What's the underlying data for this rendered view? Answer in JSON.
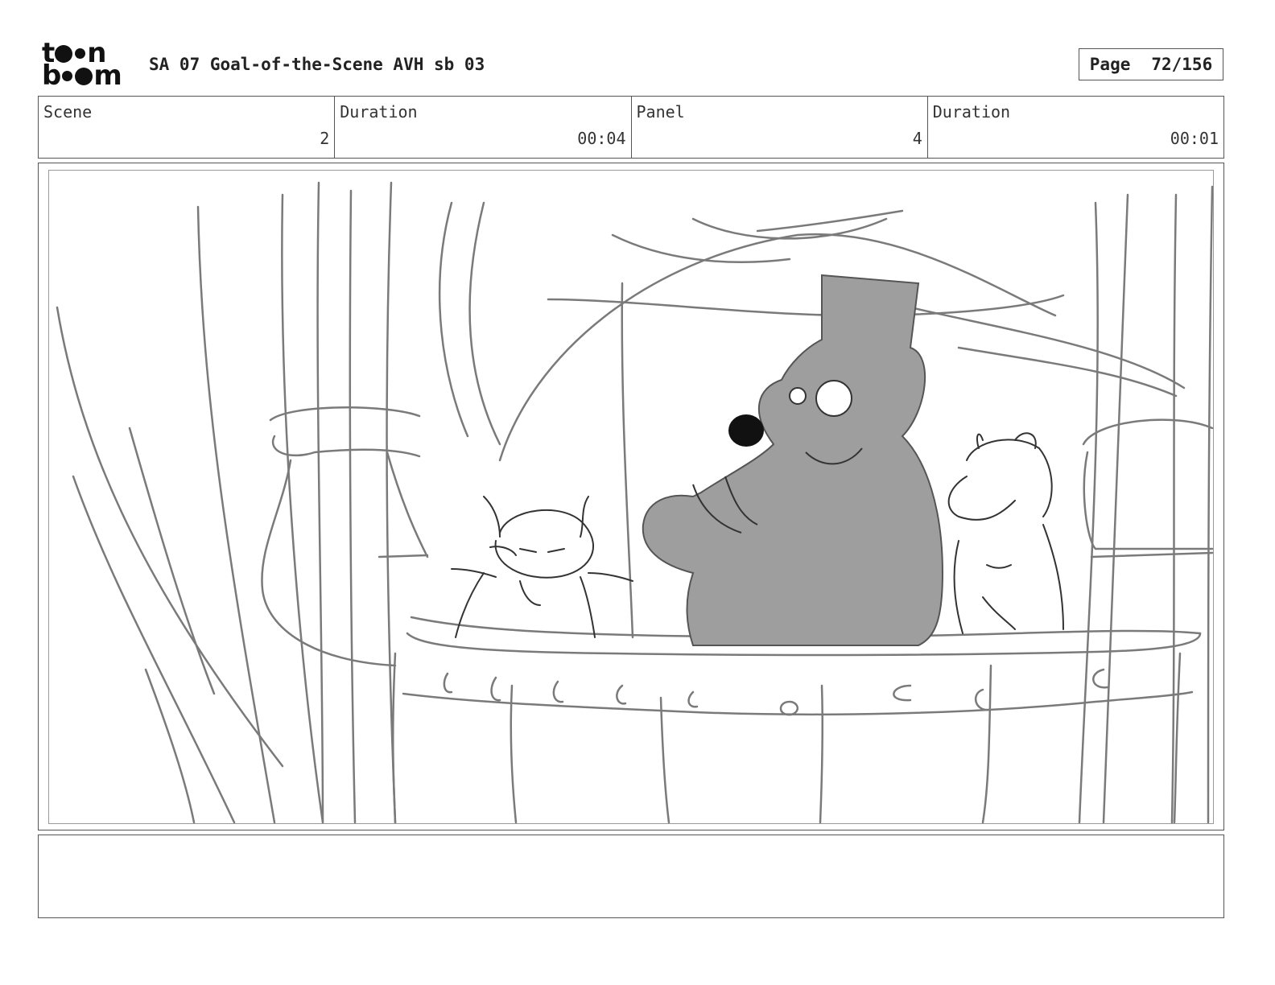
{
  "header": {
    "logo_text": "toon boom",
    "title": "SA 07 Goal-of-the-Scene AVH sb 03",
    "page_label": "Page",
    "page_number": "72/156"
  },
  "info": {
    "scene_label": "Scene",
    "scene_value": "2",
    "scene_duration_label": "Duration",
    "scene_duration_value": "00:04",
    "panel_label": "Panel",
    "panel_value": "4",
    "panel_duration_label": "Duration",
    "panel_duration_value": "00:01"
  },
  "notes": {
    "text": ""
  }
}
